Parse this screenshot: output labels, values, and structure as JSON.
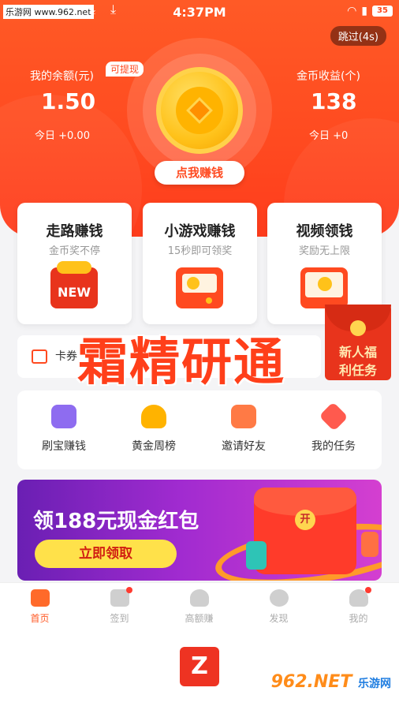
{
  "status": {
    "site_watermark": "乐游网 www.962.net",
    "time": "4:37PM",
    "battery": "35"
  },
  "header": {
    "skip_label": "跳过(4s)",
    "balance_label": "我的余额(元)",
    "withdraw_badge": "可提现",
    "balance_value": "1.50",
    "balance_today": "今日 +0.00",
    "coins_label": "金币收益(个)",
    "coins_value": "138",
    "coins_today": "今日 +0",
    "earn_button": "点我赚钱"
  },
  "cards": [
    {
      "title": "走路赚钱",
      "subtitle": "金币奖不停",
      "icon_label": "NEW"
    },
    {
      "title": "小游戏赚钱",
      "subtitle": "15秒即可领奖"
    },
    {
      "title": "视频领钱",
      "subtitle": "奖励无上限"
    }
  ],
  "ticker": {
    "text": "卡券"
  },
  "overlay_text": "霜精研通",
  "new_user_gift": {
    "line1": "新人福",
    "line2": "利任务"
  },
  "menu": [
    {
      "label": "刷宝赚钱",
      "color": "#8e6cf0"
    },
    {
      "label": "黄金周榜",
      "color": "#ffb300"
    },
    {
      "label": "邀请好友",
      "color": "#ff7a45"
    },
    {
      "label": "我的任务",
      "color": "#ff5a4e"
    }
  ],
  "banner": {
    "title": "领188元现金红包",
    "button": "立即领取",
    "envelope_mark": "开"
  },
  "nav": [
    {
      "label": "首页",
      "active": true
    },
    {
      "label": "签到"
    },
    {
      "label": "高额赚"
    },
    {
      "label": "发现"
    },
    {
      "label": "我的"
    }
  ],
  "footer": {
    "logo_letter": "Z",
    "watermark_num": "962.NET",
    "watermark_cn": "乐游网"
  },
  "colors": {
    "brand": "#ff4a20",
    "accent_yellow": "#ffc21a"
  }
}
